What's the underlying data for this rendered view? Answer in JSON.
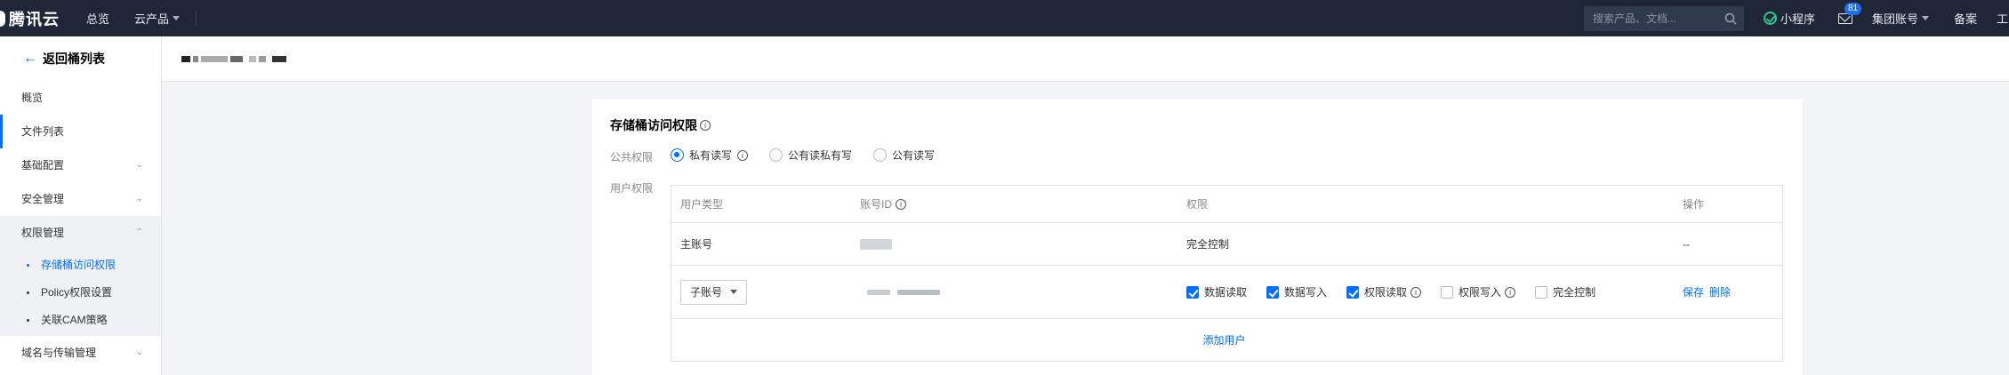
{
  "topnav": {
    "logo_text": "腾讯云",
    "links": [
      "总览",
      "云产品"
    ],
    "search_placeholder": "搜索产品、文档...",
    "mini_program": "小程序",
    "mail_badge": "81",
    "account": "集团账号",
    "beian": "备案",
    "tools": "工"
  },
  "sidebar": {
    "back_label": "返回桶列表",
    "items": [
      {
        "label": "概览"
      },
      {
        "label": "文件列表"
      },
      {
        "label": "基础配置"
      },
      {
        "label": "安全管理"
      },
      {
        "label": "权限管理"
      },
      {
        "label": "域名与传输管理"
      }
    ],
    "sub_items": [
      {
        "label": "存储桶访问权限"
      },
      {
        "label": "Policy权限设置"
      },
      {
        "label": "关联CAM策略"
      }
    ]
  },
  "card": {
    "title": "存储桶访问权限",
    "public_label": "公共权限",
    "user_label": "用户权限",
    "radios": [
      {
        "label": "私有读写",
        "checked": true
      },
      {
        "label": "公有读私有写",
        "checked": false
      },
      {
        "label": "公有读写",
        "checked": false
      }
    ],
    "table": {
      "headers": [
        "用户类型",
        "账号ID",
        "权限",
        "操作"
      ],
      "row1": {
        "type": "主账号",
        "permission": "完全控制",
        "action": "--"
      },
      "row2": {
        "type_select": "子账号",
        "perms": [
          {
            "label": "数据读取",
            "checked": true
          },
          {
            "label": "数据写入",
            "checked": true
          },
          {
            "label": "权限读取",
            "checked": true
          },
          {
            "label": "权限写入",
            "checked": false
          },
          {
            "label": "完全控制",
            "checked": false
          }
        ],
        "save": "保存",
        "delete": "删除"
      },
      "add_user": "添加用户"
    }
  }
}
